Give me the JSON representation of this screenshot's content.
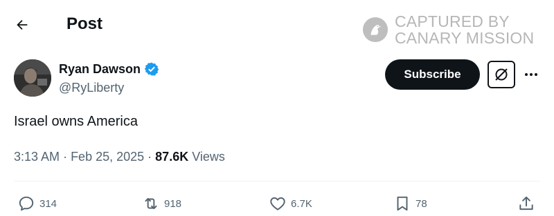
{
  "header": {
    "title": "Post",
    "watermark_text": "CAPTURED BY\nCANARY MISSION"
  },
  "author": {
    "name": "Ryan Dawson",
    "handle": "@RyLiberty",
    "verified": true
  },
  "buttons": {
    "subscribe_label": "Subscribe"
  },
  "post": {
    "text": "Israel owns America",
    "time": "3:13 AM",
    "date": "Feb 25, 2025",
    "views_count": "87.6K",
    "views_label": "Views"
  },
  "actions": {
    "replies": "314",
    "reposts": "918",
    "likes": "6.7K",
    "bookmarks": "78"
  },
  "colors": {
    "text_primary": "#0f1419",
    "text_secondary": "#536471",
    "verified_blue": "#1d9bf0",
    "button_dark": "#0f1419"
  }
}
